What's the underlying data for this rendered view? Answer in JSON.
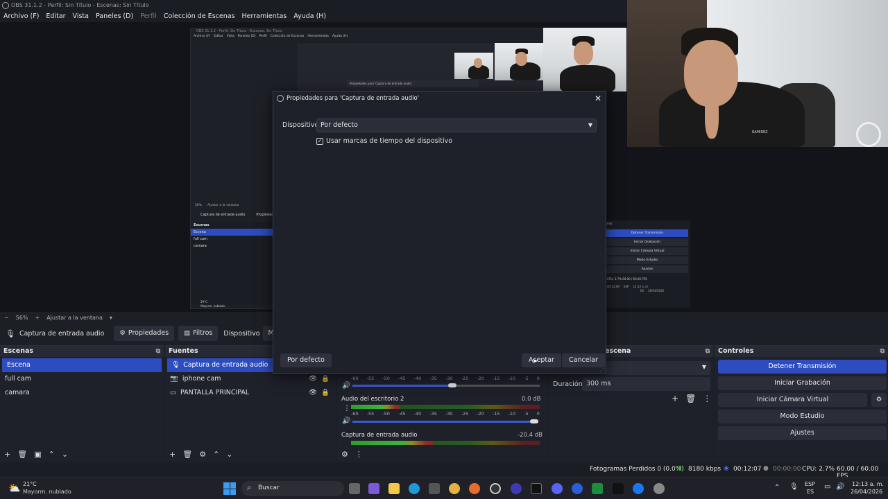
{
  "window": {
    "title": "OBS 31.1.2 - Perfil: Sin Título - Escenas: Sin Título"
  },
  "menu": [
    "Archivo (F)",
    "Editar",
    "Vista",
    "Paneles (D)",
    "Perfil",
    "Colección de Escenas",
    "Herramientas",
    "Ayuda (H)"
  ],
  "zoom": {
    "minus": "−",
    "value": "56%",
    "plus": "+",
    "fit": "Ajustar a la ventana",
    "arrow": "▾"
  },
  "source_toolbar": {
    "source_name": "Captura de entrada audio",
    "properties": "Propiedades",
    "filters": "Filtros",
    "device_label": "Dispositivo",
    "device_value": "Micrófono ("
  },
  "scenes": {
    "title": "Escenas",
    "items": [
      "Escena",
      "full cam",
      "camara"
    ],
    "selected": 0
  },
  "sources": {
    "title": "Fuentes",
    "items": [
      "Captura de entrada audio",
      "iphone cam",
      "PANTALLA PRINCIPAL"
    ],
    "selected": 0
  },
  "mixer": {
    "scale": [
      "-60",
      "-55",
      "-50",
      "-45",
      "-40",
      "-35",
      "-30",
      "-25",
      "-20",
      "-15",
      "-10",
      "-5",
      "0"
    ],
    "channels": [
      {
        "name": "Audio del escritorio 2",
        "db": "0.0 dB"
      },
      {
        "name": "Captura de entrada audio",
        "db": "-20.4 dB"
      }
    ]
  },
  "transitions": {
    "title": "escena",
    "duration_label": "Duración",
    "duration_value": "300 ms"
  },
  "controls": {
    "title": "Controles",
    "buttons": [
      "Detener Transmisión",
      "Iniciar Grabación",
      "Iniciar Cámara Virtual",
      "Modo Estudio",
      "Ajustes"
    ]
  },
  "status": {
    "dropped": "Fotogramas Perdidos 0 (0.0%)",
    "bitrate": "8180 kbps",
    "stream_time": "00:12:07",
    "rec_time": "00:00:00",
    "cpu": "CPU: 2.7%",
    "fps": "60.00 / 60.00 FPS"
  },
  "dialog": {
    "title": "Propiedades para 'Captura de entrada audio'",
    "device_label": "Dispositivo",
    "device_value": "Por defecto",
    "checkbox_label": "Usar marcas de tiempo del dispositivo",
    "checkbox_checked": true,
    "defaults_button": "Por defecto",
    "ok_button": "Aceptar",
    "cancel_button": "Cancelar"
  },
  "nested_preview": {
    "title": "OBS 31.1.2 - Perfil: Sin Título - Escenas: Sin Título",
    "menu": [
      "Archivo (F)",
      "Editar",
      "Vista",
      "Paneles (D)",
      "Perfil",
      "Colección de Escenas",
      "Herramientas",
      "Ayuda (H)"
    ],
    "dialog_title": "Propiedades para 'Captura de entrada audio'",
    "zoom": "56%",
    "fit": "Ajustar a la ventana",
    "source": "Captura de entrada audio",
    "properties": "Propiedades",
    "scenes_title": "Escenas",
    "scenes": [
      "Escena",
      "full cam",
      "camara"
    ],
    "controls_title": "ilos",
    "controls": [
      "Detener Transmisión",
      "Iniciar Grabación",
      "Iniciar Cámara Virtual",
      "Modo Estudio",
      "Ajustes"
    ],
    "status": "CPU: 2.7%    60.00 / 60.00 FPS",
    "stream": "00:12:06",
    "weather": "29°C",
    "weather_desc": "Mayorm. nublado",
    "clock": "12:13 a. m.",
    "date": "26/04/2026",
    "lang": "ESP",
    "region": "ES"
  },
  "camera_badge": {
    "shirt_text": "RAMIREZ"
  },
  "taskbar": {
    "weather_temp": "21°C",
    "weather_desc": "Mayorm. nublado",
    "search": "Buscar",
    "lang": "ESP",
    "region": "ES",
    "time": "12:13 a. m.",
    "date": "26/04/2026"
  },
  "colors": {
    "accent": "#2d4cbf",
    "bg": "#1f212a"
  }
}
